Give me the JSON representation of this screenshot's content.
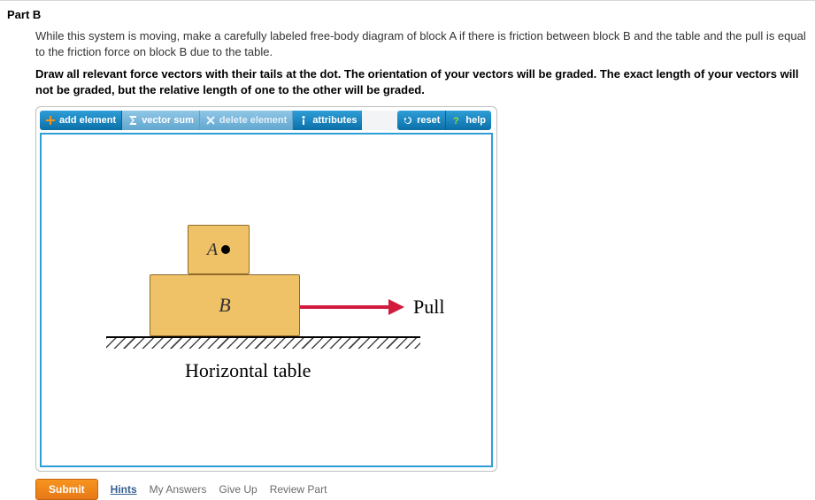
{
  "part_label": "Part B",
  "prompt": "While this system is moving, make a carefully labeled free-body diagram of block A if there is friction between block B and the table and the pull is equal to the friction force on block B due to the table.",
  "instruction_bold": "Draw all relevant force vectors with their tails at the dot. The orientation of your vectors will be graded. The exact length of your vectors will not be graded, but the relative length of one to the other will be graded.",
  "toolbar": {
    "add": "add element",
    "sum": "vector sum",
    "delete": "delete element",
    "attributes": "attributes",
    "reset": "reset",
    "help": "help"
  },
  "diagram": {
    "block_a": "A",
    "block_b": "B",
    "pull": "Pull",
    "table": "Horizontal table"
  },
  "footer": {
    "submit": "Submit",
    "hints": "Hints",
    "my_answers": "My Answers",
    "give_up": "Give Up",
    "review": "Review Part"
  }
}
